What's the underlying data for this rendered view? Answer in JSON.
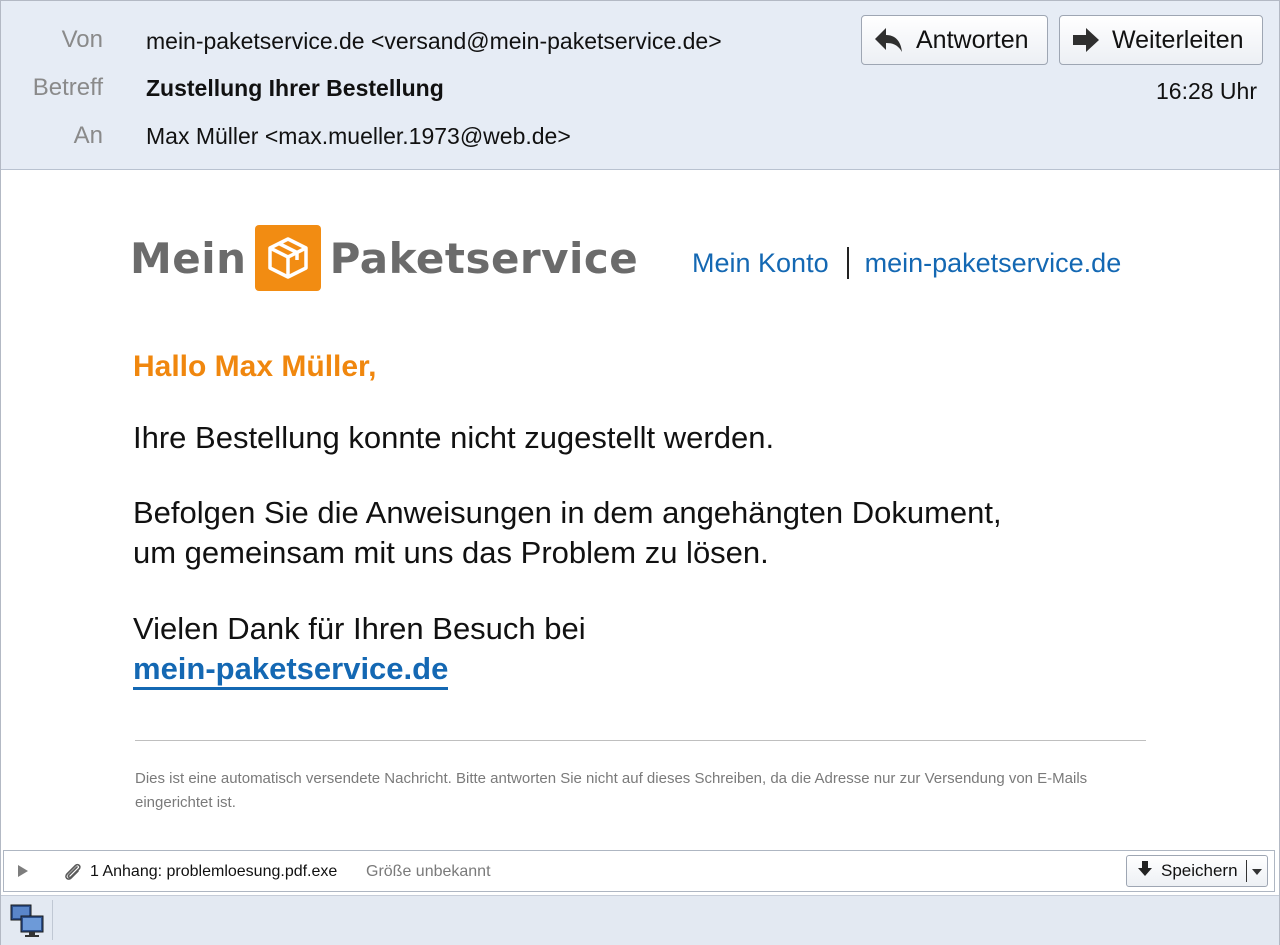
{
  "header": {
    "from_label": "Von",
    "from_value": "mein-paketservice.de <versand@mein-paketservice.de>",
    "subject_label": "Betreff",
    "subject_value": "Zustellung Ihrer Bestellung",
    "to_label": "An",
    "to_value": "Max Müller <max.mueller.1973@web.de>",
    "reply_label": "Antworten",
    "forward_label": "Weiterleiten",
    "time": "16:28 Uhr"
  },
  "brand": {
    "word1": "Mein",
    "word2": "Paketservice",
    "accent": "#f28c12",
    "link_color": "#1468b3"
  },
  "toplinks": {
    "account": "Mein Konto",
    "site": "mein-paketservice.de"
  },
  "message": {
    "greeting": "Hallo Max Müller,",
    "line1": "Ihre Bestellung konnte nicht zugestellt werden.",
    "line2a": "Befolgen Sie die Anweisungen in dem angehängten Dokument,",
    "line2b": "um gemeinsam mit uns das Problem zu lösen.",
    "line3": "Vielen Dank für Ihren Besuch bei",
    "link": "mein-paketservice.de",
    "footnote": "Dies ist eine automatisch versendete Nachricht. Bitte antworten Sie nicht auf dieses Schreiben, da die Adresse nur zur Versendung von E-Mails eingerichtet ist."
  },
  "attachment": {
    "name": "1 Anhang: problemloesung.pdf.exe",
    "size": "Größe unbekannt",
    "save_label": "Speichern"
  },
  "icons": {
    "reply": "reply-arrow-icon",
    "forward": "forward-arrow-icon",
    "package": "package-box-icon",
    "paperclip": "paperclip-icon",
    "save": "download-arrow-icon",
    "dropdown": "chevron-down-icon",
    "network": "network-computers-icon"
  }
}
